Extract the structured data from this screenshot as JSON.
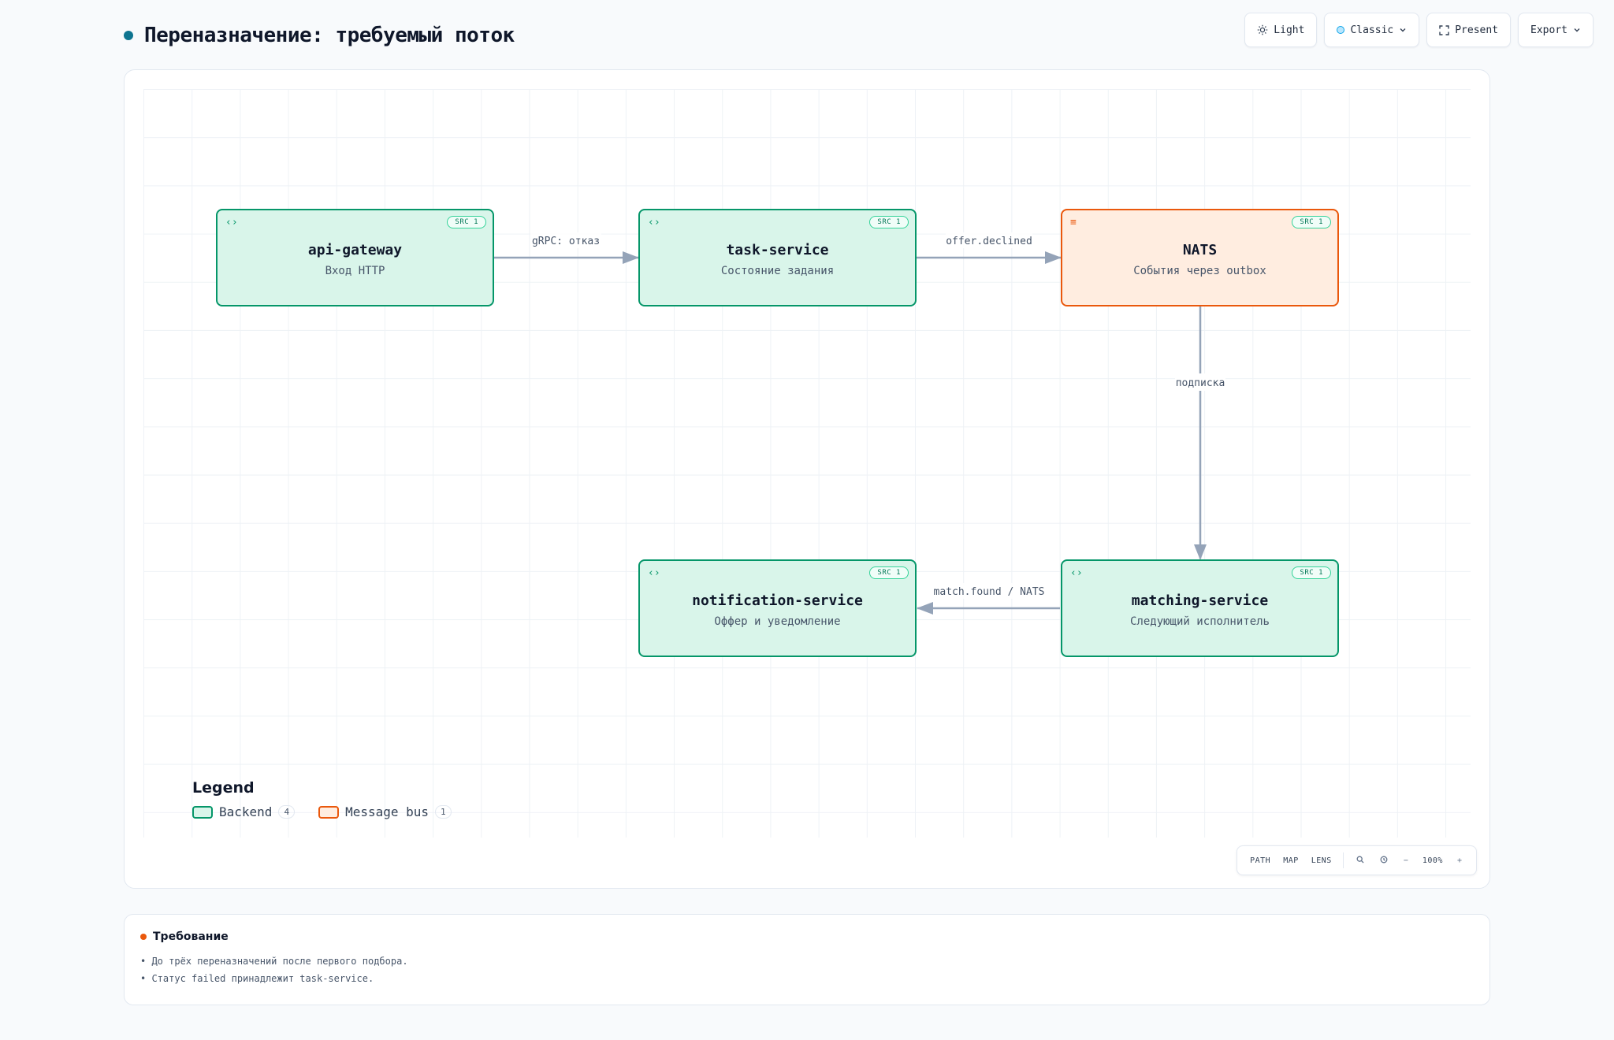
{
  "header": {
    "title": "Переназначение: требуемый поток"
  },
  "toolbar": {
    "theme_label": "Light",
    "style_label": "Classic",
    "present_label": "Present",
    "export_label": "Export"
  },
  "diagram": {
    "nodes": [
      {
        "id": "api-gateway",
        "title": "api-gateway",
        "subtitle": "Вход HTTP",
        "badge": "SRC 1",
        "kind": "backend"
      },
      {
        "id": "task-service",
        "title": "task-service",
        "subtitle": "Состояние задания",
        "badge": "SRC 1",
        "kind": "backend"
      },
      {
        "id": "nats",
        "title": "NATS",
        "subtitle": "События через outbox",
        "badge": "SRC 1",
        "kind": "bus"
      },
      {
        "id": "notification-service",
        "title": "notification-service",
        "subtitle": "Оффер и уведомление",
        "badge": "SRC 1",
        "kind": "backend"
      },
      {
        "id": "matching-service",
        "title": "matching-service",
        "subtitle": "Следующий исполнитель",
        "badge": "SRC 1",
        "kind": "backend"
      }
    ],
    "edges": [
      {
        "from": "api-gateway",
        "to": "task-service",
        "label": "gRPC: отказ"
      },
      {
        "from": "task-service",
        "to": "nats",
        "label": "offer.declined"
      },
      {
        "from": "nats",
        "to": "matching-service",
        "label": "подписка"
      },
      {
        "from": "matching-service",
        "to": "notification-service",
        "label": "match.found / NATS"
      }
    ]
  },
  "legend": {
    "title": "Legend",
    "items": [
      {
        "label": "Backend",
        "count": "4",
        "kind": "backend"
      },
      {
        "label": "Message bus",
        "count": "1",
        "kind": "bus"
      }
    ]
  },
  "controls": {
    "path": "PATH",
    "map": "MAP",
    "lens": "LENS",
    "zoom": "100%",
    "zoom_out": "−",
    "zoom_in": "+"
  },
  "requirement": {
    "title": "Требование",
    "items": [
      "• До трёх переназначений после первого подбора.",
      "• Статус failed принадлежит task-service."
    ]
  },
  "colors": {
    "backend_border": "#059669",
    "backend_fill": "#d9f5ea",
    "bus_border": "#ea580c",
    "bus_fill": "#ffede0",
    "edge": "#94a3b8",
    "accent": "#0e7490"
  }
}
